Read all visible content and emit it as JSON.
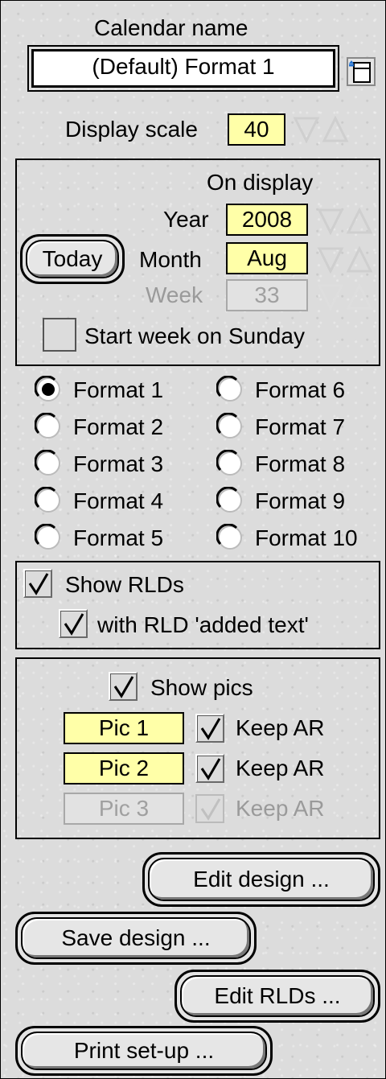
{
  "calendar_name": {
    "label": "Calendar name",
    "value": "(Default) Format 1",
    "pick_icon": "menu-popup-icon"
  },
  "display_scale": {
    "label": "Display scale",
    "value": "40"
  },
  "on_display": {
    "heading": "On display",
    "today_label": "Today",
    "year_label": "Year",
    "year_value": "2008",
    "month_label": "Month",
    "month_value": "Aug",
    "week_label": "Week",
    "week_value": "33",
    "start_week_label": "Start week on Sunday",
    "start_week_checked": false
  },
  "formats": {
    "selected": "Format 1",
    "left": [
      "Format 1",
      "Format 2",
      "Format 3",
      "Format 4",
      "Format 5"
    ],
    "right": [
      "Format 6",
      "Format 7",
      "Format 8",
      "Format 9",
      "Format 10"
    ]
  },
  "rlds": {
    "show_label": "Show RLDs",
    "show_checked": true,
    "added_text_label": "with RLD 'added text'",
    "added_text_checked": true
  },
  "pics": {
    "show_label": "Show pics",
    "show_checked": true,
    "pic1_label": "Pic 1",
    "pic1_keep": "Keep AR",
    "pic2_label": "Pic 2",
    "pic2_keep": "Keep AR",
    "pic3_label": "Pic 3",
    "pic3_keep": "Keep AR"
  },
  "buttons": {
    "edit_design": "Edit design ...",
    "save_design": "Save design ...",
    "edit_rlds": "Edit RLDs ...",
    "print_setup": "Print set-up ..."
  },
  "colors": {
    "field_bg": "#ffffa8",
    "window_bg": "#dcdcdc"
  }
}
